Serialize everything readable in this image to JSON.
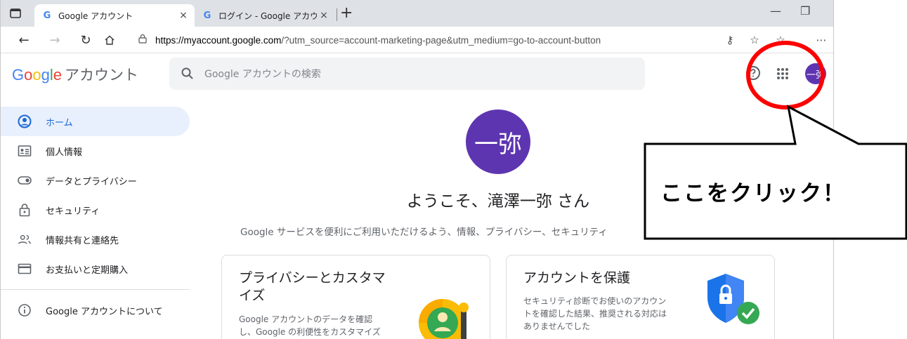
{
  "browser": {
    "tabs": [
      {
        "title": "Google アカウント",
        "favicon": "G",
        "active": true
      },
      {
        "title": "ログイン - Google アカウント",
        "favicon": "G",
        "active": false
      }
    ],
    "tab_close": "×",
    "new_tab": "+",
    "url_host": "https://myaccount.google.com",
    "url_path": "/?utm_source=account-marketing-page&utm_medium=go-to-account-button"
  },
  "header": {
    "logo": [
      "G",
      "o",
      "o",
      "g",
      "l",
      "e"
    ],
    "logo_sub": "アカウント",
    "search_placeholder": "Google アカウントの検索",
    "avatar_initial": "一弥"
  },
  "sidebar": {
    "items": [
      {
        "label": "ホーム",
        "icon": "account-circle-icon"
      },
      {
        "label": "個人情報",
        "icon": "id-card-icon"
      },
      {
        "label": "データとプライバシー",
        "icon": "toggle-icon"
      },
      {
        "label": "セキュリティ",
        "icon": "lock-icon"
      },
      {
        "label": "情報共有と連絡先",
        "icon": "people-icon"
      },
      {
        "label": "お支払いと定期購入",
        "icon": "credit-card-icon"
      }
    ],
    "about": {
      "label": "Google アカウントについて",
      "icon": "info-icon"
    }
  },
  "main": {
    "avatar_initial": "一弥",
    "welcome": "ようこそ、滝澤一弥 さん",
    "intro": "Google サービスを便利にご利用いただけるよう、情報、プライバシー、セキュリティ",
    "cards": [
      {
        "title_line1": "プライバシーとカスタマ",
        "title_line2": "イズ",
        "desc_line1": "Google アカウントのデータを確認",
        "desc_line2": "し、Google の利便性をカスタマイズ"
      },
      {
        "title_line1": "アカウントを保護",
        "desc_line1": "セキュリティ診断でお使いのアカウン",
        "desc_line2": "トを確認した結果、推奨される対応は",
        "desc_line3": "ありませんでした"
      }
    ]
  },
  "callout": {
    "text": "ここをクリック！",
    "circle_color": "#ff0000"
  },
  "colors": {
    "accent": "#1967d2",
    "avatar": "#5e35b1",
    "google_blue": "#4285f4",
    "google_red": "#ea4335",
    "google_yellow": "#fbbc05",
    "google_green": "#34a853"
  }
}
